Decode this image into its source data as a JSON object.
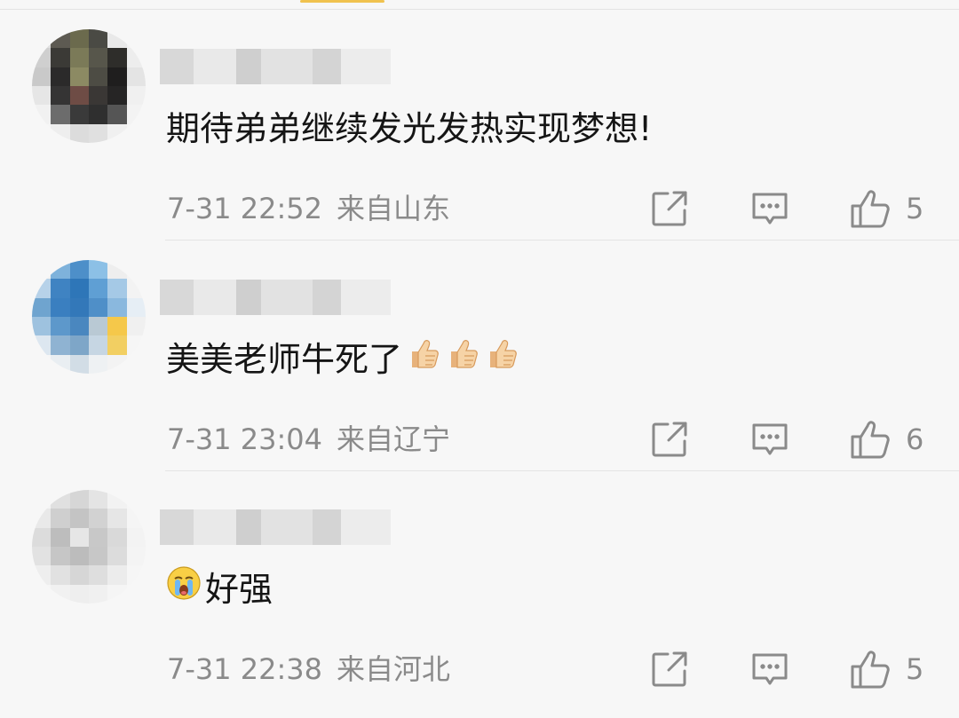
{
  "comments": [
    {
      "text": "期待弟弟继续发光发热实现梦想!",
      "emojis": [],
      "lead_emoji": "",
      "date": "7-31 22:52",
      "location": "来自山东",
      "like_count": "5",
      "avatar_palette": [
        "#dedede",
        "#5d5a52",
        "#6b6a4d",
        "#4a4a44",
        "#e9e9e9",
        "#f2f2f2",
        "#cfcfcf",
        "#3b3a36",
        "#7b7a58",
        "#57564b",
        "#2e2d2a",
        "#ededed",
        "#c9c9c9",
        "#2b2a2a",
        "#8c8a63",
        "#4d4c44",
        "#1f1e1e",
        "#e4e4e4",
        "#e6e6e6",
        "#353434",
        "#6e4c45",
        "#3a3735",
        "#262525",
        "#f0f0f0",
        "#f1f1f1",
        "#6c6c6c",
        "#3a3a3a",
        "#2f2f2f",
        "#555555",
        "#f3f3f3",
        "#f6f6f6",
        "#eeeeee",
        "#dcdcdc",
        "#e0e0e0",
        "#f0f0f0",
        "#f6f6f6"
      ]
    },
    {
      "text": "美美老师牛死了",
      "emojis": [
        "thumbs-up",
        "thumbs-up",
        "thumbs-up"
      ],
      "lead_emoji": "",
      "date": "7-31 23:04",
      "location": "来自辽宁",
      "like_count": "6",
      "avatar_palette": [
        "#f2f2f2",
        "#7eb2db",
        "#4d8fc9",
        "#8cc0e6",
        "#eeeeee",
        "#f4f4f4",
        "#b7d2e9",
        "#3f83c2",
        "#2e76b8",
        "#5f9fd4",
        "#a5c9e6",
        "#f3f3f3",
        "#6fa4cf",
        "#3a7fc0",
        "#3378b9",
        "#4f8fc8",
        "#8ab8de",
        "#e6eef5",
        "#9ec2df",
        "#5d98cb",
        "#4a87bf",
        "#b9c9d4",
        "#f5c84a",
        "#f0f0f0",
        "#dde7f0",
        "#8fb3d2",
        "#7ea6c8",
        "#c6d6e3",
        "#f2cf62",
        "#f6f6f6",
        "#f6f6f6",
        "#e9eef2",
        "#d2dde6",
        "#eef1f3",
        "#f3f3f3",
        "#f7f7f7"
      ]
    },
    {
      "text": "好强",
      "emojis": [],
      "lead_emoji": "crying-face",
      "date": "7-31 22:38",
      "location": "来自河北",
      "like_count": "5",
      "avatar_palette": [
        "#f4f4f4",
        "#e0e0e0",
        "#d6d6d6",
        "#e4e4e4",
        "#f2f2f2",
        "#f6f6f6",
        "#e9e9e9",
        "#cfcfcf",
        "#c4c4c4",
        "#d2d2d2",
        "#e6e6e6",
        "#f5f5f5",
        "#dcdcdc",
        "#bdbdbd",
        "#e6e6e6",
        "#c8c8c8",
        "#d9d9d9",
        "#f3f3f3",
        "#e2e2e2",
        "#c6c6c6",
        "#bcbcbc",
        "#c7c7c7",
        "#dcdcdc",
        "#f4f4f4",
        "#eeeeee",
        "#e1e1e1",
        "#d6d6d6",
        "#dedede",
        "#ececec",
        "#f6f6f6",
        "#f6f6f6",
        "#f1f1f1",
        "#eeeeee",
        "#f0f0f0",
        "#f5f5f5",
        "#f7f7f7"
      ]
    }
  ],
  "colors": {
    "background": "#f7f7f7",
    "text": "#151515",
    "meta": "#8a8a8a",
    "divider": "#e4e4e4",
    "accent": "#f0c24f"
  }
}
